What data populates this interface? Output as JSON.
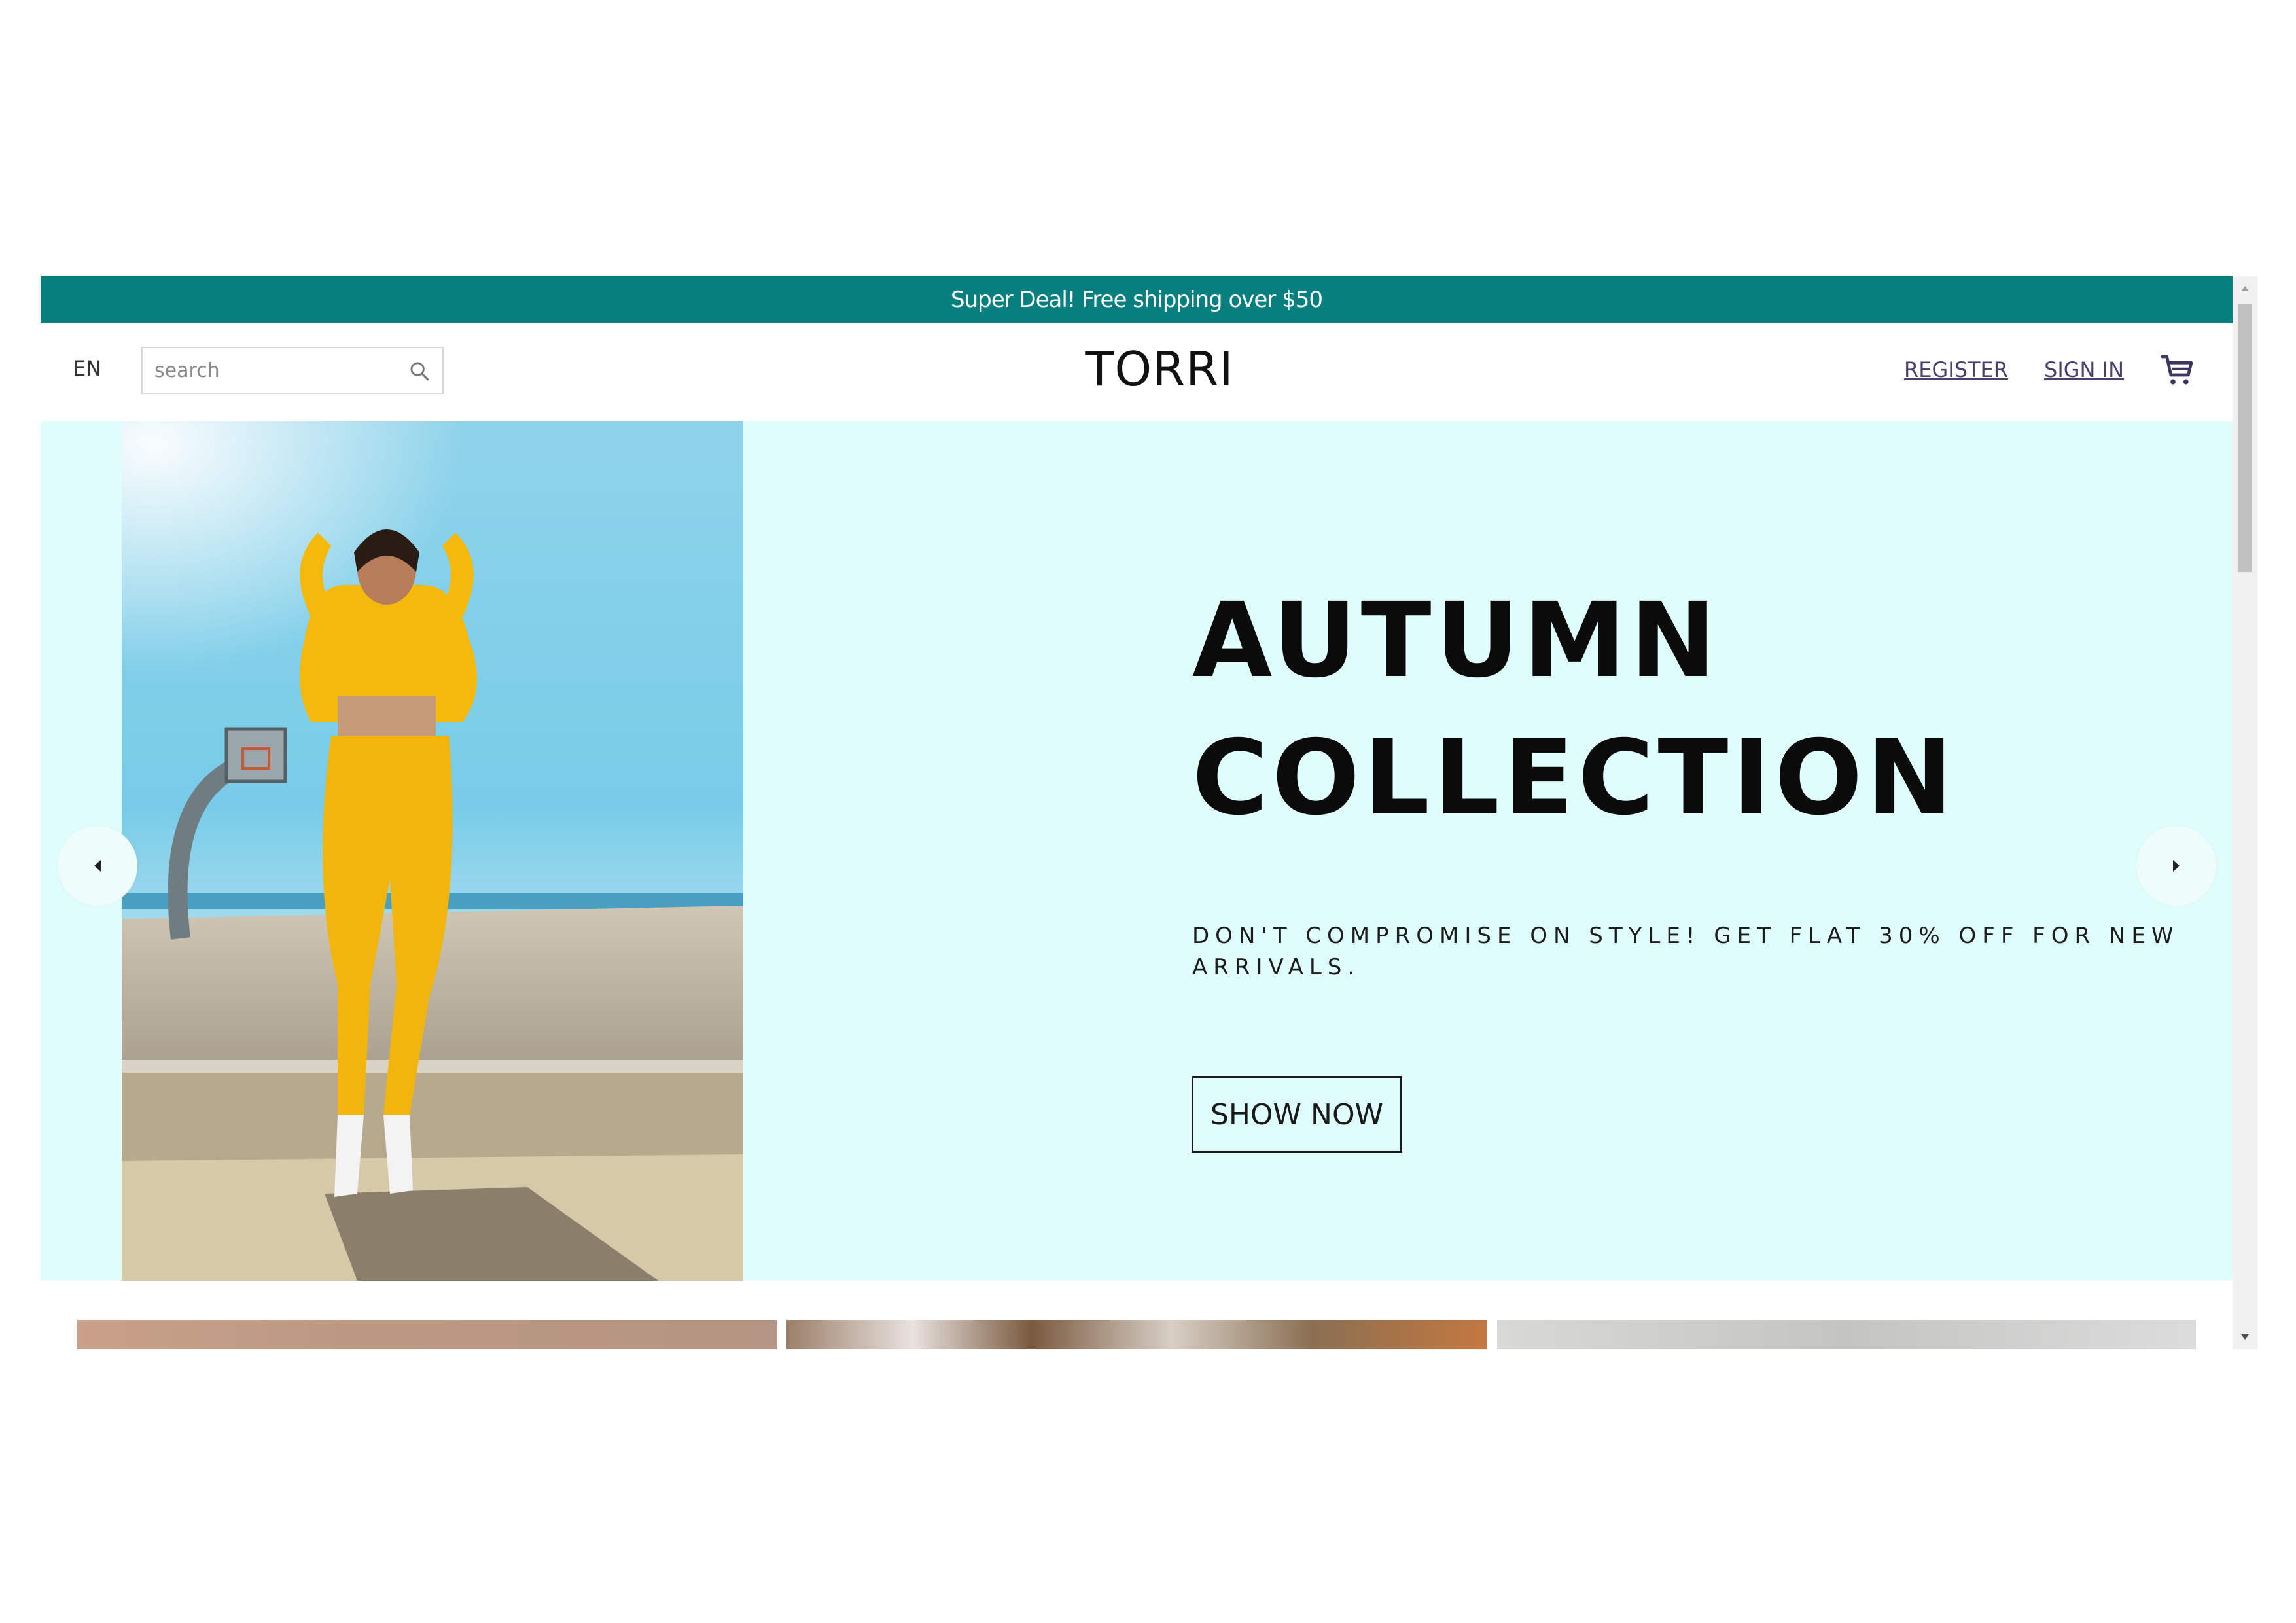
{
  "promo": {
    "text": "Super Deal! Free shipping over $50"
  },
  "header": {
    "language": "EN",
    "search_placeholder": "search",
    "logo": "TORRI",
    "register": "REGISTER",
    "signin": "SIGN IN"
  },
  "hero": {
    "title_line1": "AUTUMN",
    "title_line2": "COLLECTION",
    "subtitle": "DON'T COMPROMISE ON STYLE! GET FLAT 30% OFF FOR NEW ARRIVALS.",
    "cta": "SHOW NOW"
  },
  "icons": {
    "search": "search-icon",
    "cart": "cart-icon",
    "prev": "chevron-left-icon",
    "next": "chevron-right-icon"
  },
  "colors": {
    "promo_bg": "#087f7f",
    "hero_bg": "#dffdfb",
    "link": "#4a3f6b"
  }
}
